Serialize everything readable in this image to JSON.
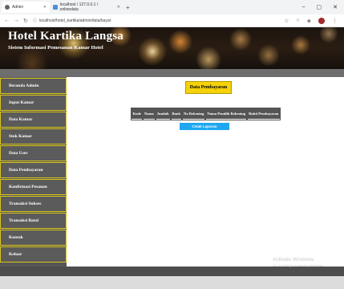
{
  "browser": {
    "tabs": [
      {
        "label": "Admin"
      },
      {
        "label": "localhost / 127.0.0.1 / onlinedata"
      }
    ],
    "window_controls": {
      "minimize": "–",
      "maximize": "▢",
      "close": "✕"
    },
    "url": "localhost/hotel_kartika/admin/data/bayar"
  },
  "header": {
    "title": "Hotel Kartika Langsa",
    "subtitle": "Sistem Informasi Pemesanan Kamar Hotel"
  },
  "sidebar": {
    "items": [
      {
        "label": "Beranda Admin"
      },
      {
        "label": "Input Kamar"
      },
      {
        "label": "Data Kamar"
      },
      {
        "label": "Stok Kamar"
      },
      {
        "label": "Data User"
      },
      {
        "label": "Data Pembayaran"
      },
      {
        "label": "Konfirmasi Pesanan"
      },
      {
        "label": "Transaksi Sukses"
      },
      {
        "label": "Transaksi Batal"
      },
      {
        "label": "Kontak"
      },
      {
        "label": "Keluar"
      }
    ]
  },
  "main": {
    "heading": "Data Pembayaran",
    "table_headers": [
      "Kode",
      "Nama",
      "Jumlah",
      "Bank",
      "No Rekening",
      "Nama Pemilik Rekening",
      "Bukti Pembayaran"
    ],
    "print_button": "Cetak Laporan"
  },
  "watermark": {
    "line1": "Activate Windows",
    "line2": "Go to Settings to activate Windows."
  },
  "colors": {
    "accent_yellow": "#f5d20a",
    "sidebar_border": "#d8c51a",
    "button_blue": "#1ea7f0",
    "table_header": "#555555"
  }
}
